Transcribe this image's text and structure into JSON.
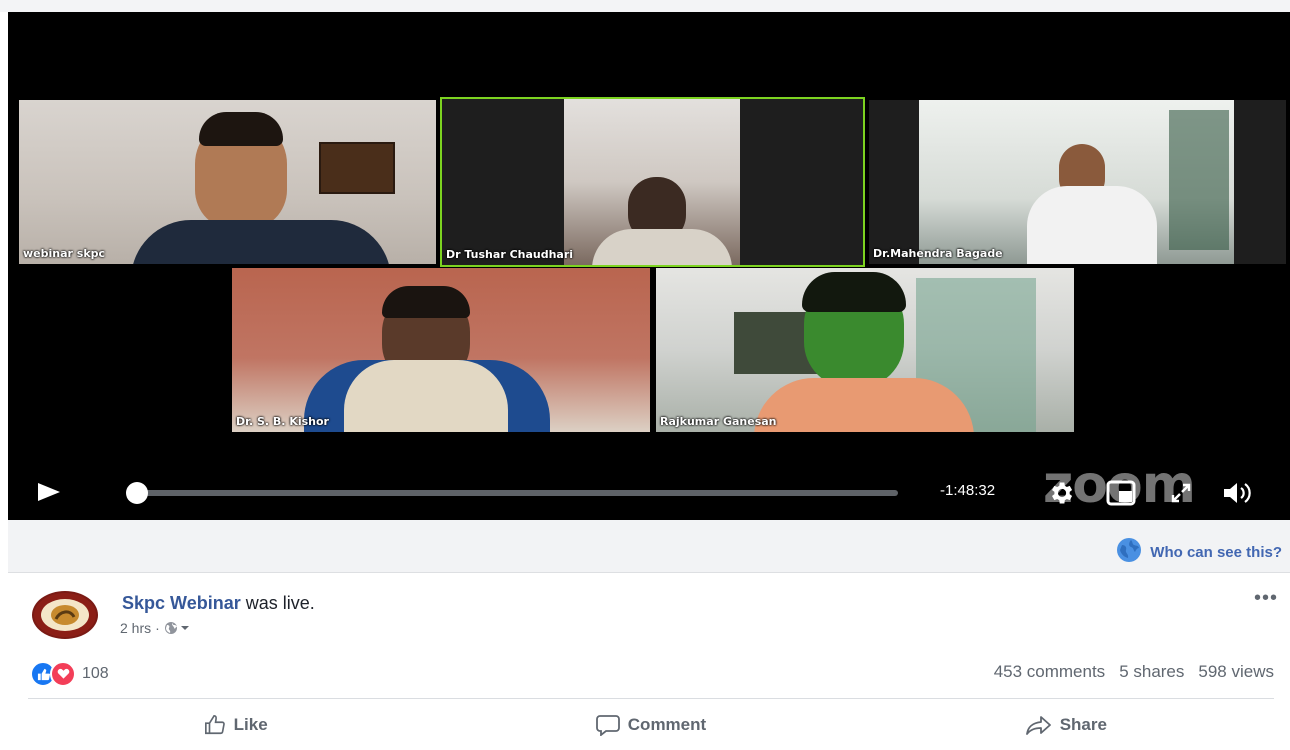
{
  "video": {
    "participants": [
      {
        "name": "webinar skpc"
      },
      {
        "name": "Dr Tushar Chaudhari"
      },
      {
        "name": "Dr.Mahendra Bagade"
      },
      {
        "name": "Dr. S. B. Kishor"
      },
      {
        "name": "Rajkumar Ganesan"
      }
    ],
    "active_speaker_color": "#7cd320",
    "time_remaining": "-1:48:32",
    "watermark": "zoom",
    "progress": 0.0,
    "icons": {
      "play": "play-icon",
      "settings": "gear-icon",
      "pip": "picture-in-picture-icon",
      "fullscreen": "fullscreen-icon",
      "volume": "volume-icon"
    }
  },
  "visibility": {
    "label": "Who can see this?",
    "icon": "globe-icon"
  },
  "post": {
    "page_name": "Skpc Webinar",
    "status": " was live.",
    "time": "2 hrs",
    "audience_icon": "globe-icon",
    "more": "•••",
    "reaction_count": "108",
    "comments": "453 comments",
    "shares": "5 shares",
    "views": "598 views",
    "actions": {
      "like": "Like",
      "comment": "Comment",
      "share": "Share"
    },
    "colors": {
      "link": "#365899",
      "like": "#1877f2",
      "love": "#f33e58"
    }
  }
}
